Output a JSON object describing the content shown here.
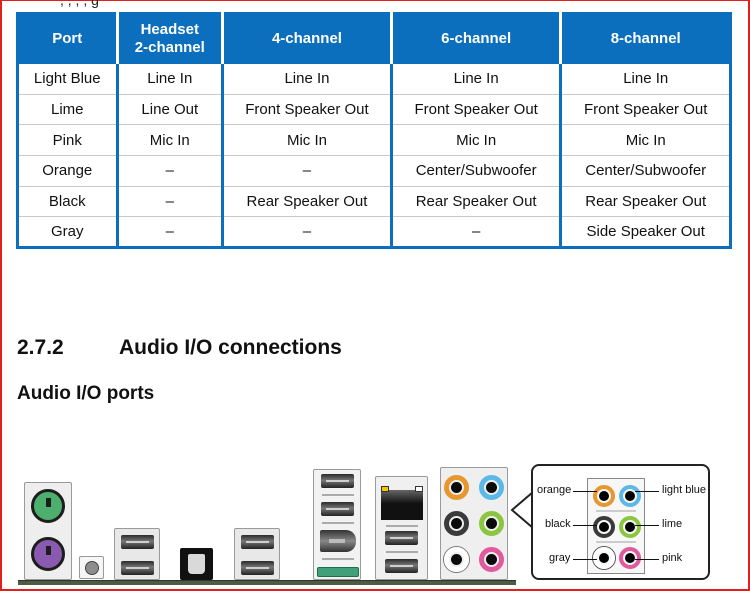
{
  "document": {
    "cut_off_text": ", , , ,                                         g",
    "table": {
      "headers": [
        "Port",
        "Headset\n2-channel",
        "4-channel",
        "6-channel",
        "8-channel"
      ],
      "header_lines": [
        [
          "Port"
        ],
        [
          "Headset",
          "2-channel"
        ],
        [
          "4-channel"
        ],
        [
          "6-channel"
        ],
        [
          "8-channel"
        ]
      ],
      "rows": [
        [
          "Light Blue",
          "Line In",
          "Line In",
          "Line In",
          "Line In"
        ],
        [
          "Lime",
          "Line Out",
          "Front Speaker Out",
          "Front Speaker Out",
          "Front Speaker Out"
        ],
        [
          "Pink",
          "Mic In",
          "Mic In",
          "Mic In",
          "Mic In"
        ],
        [
          "Orange",
          "–",
          "–",
          "Center/Subwoofer",
          "Center/Subwoofer"
        ],
        [
          "Black",
          "–",
          "Rear Speaker Out",
          "Rear Speaker Out",
          "Rear Speaker Out"
        ],
        [
          "Gray",
          "–",
          "–",
          "–",
          "Side Speaker Out"
        ]
      ]
    },
    "section": {
      "number": "2.7.2",
      "title": "Audio I/O connections"
    },
    "subheading": "Audio I/O ports",
    "figure": {
      "callout_labels": {
        "orange": "orange",
        "light_blue": "light blue",
        "black": "black",
        "lime": "lime",
        "gray": "gray",
        "pink": "pink"
      },
      "jack_colors": {
        "orange": "#e8962e",
        "light_blue": "#5cb8e6",
        "black": "#3a3a3a",
        "lime": "#8cc63f",
        "gray": "#ffffff",
        "pink": "#e05a9e"
      }
    }
  },
  "colors": {
    "table_header": "#0b6fbd",
    "frame_border": "#e0201f",
    "ps2_keyboard": "#4caf6e",
    "ps2_mouse": "#8a5ab0"
  }
}
